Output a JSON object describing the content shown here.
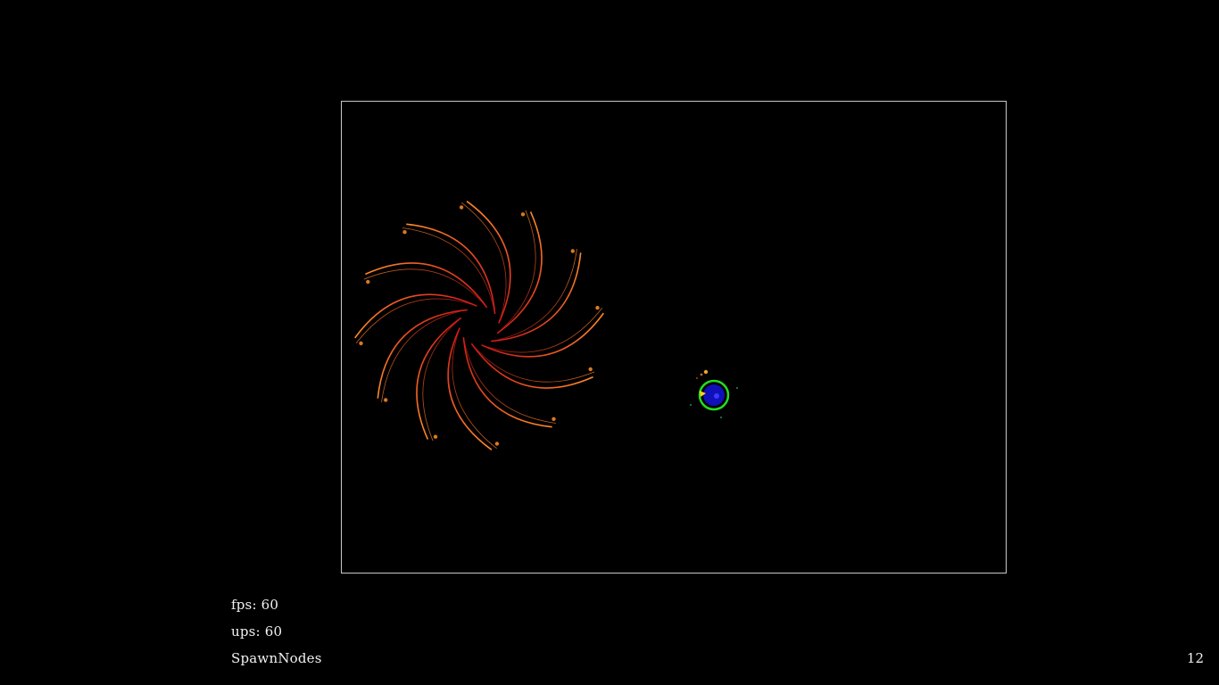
{
  "hud": {
    "fps_label": "fps: 60",
    "ups_label": "ups: 60",
    "state_label": "SpawnNodes",
    "counter": "12"
  },
  "colors": {
    "background": "#000000",
    "arena_border": "#c8c8c8",
    "tendril_inner": "#d01818",
    "tendril_outer": "#ff8a2a",
    "spore": "#d97a1e",
    "player_ring": "#22dd22",
    "player_core": "#1010b8",
    "player_marker": "#ffd21f"
  },
  "scene": {
    "boss": {
      "name": "spiral-spawner",
      "arm_count": 12,
      "spore_count": 12
    },
    "player": {
      "name": "player-ship"
    }
  }
}
